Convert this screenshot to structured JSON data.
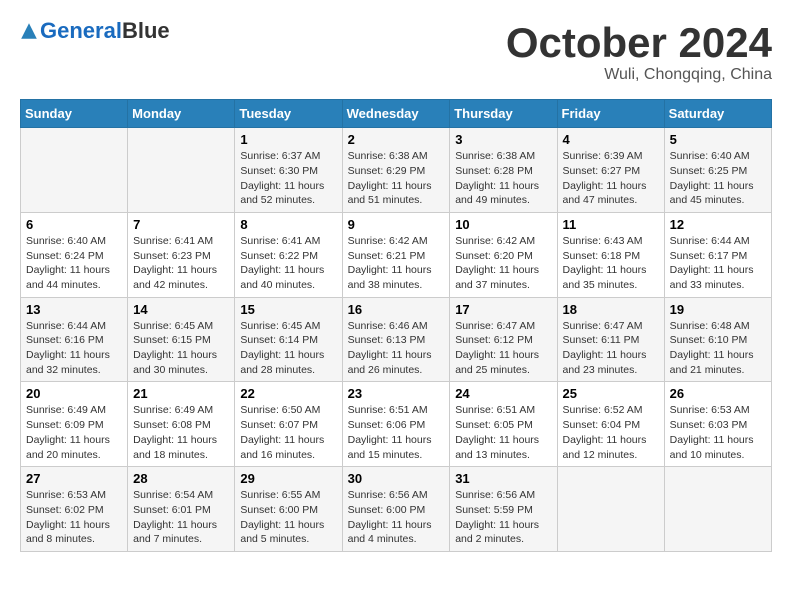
{
  "header": {
    "logo_line1": "General",
    "logo_line2": "Blue",
    "month": "October 2024",
    "location": "Wuli, Chongqing, China"
  },
  "days_of_week": [
    "Sunday",
    "Monday",
    "Tuesday",
    "Wednesday",
    "Thursday",
    "Friday",
    "Saturday"
  ],
  "weeks": [
    [
      {
        "day": "",
        "info": ""
      },
      {
        "day": "",
        "info": ""
      },
      {
        "day": "1",
        "info": "Sunrise: 6:37 AM\nSunset: 6:30 PM\nDaylight: 11 hours and 52 minutes."
      },
      {
        "day": "2",
        "info": "Sunrise: 6:38 AM\nSunset: 6:29 PM\nDaylight: 11 hours and 51 minutes."
      },
      {
        "day": "3",
        "info": "Sunrise: 6:38 AM\nSunset: 6:28 PM\nDaylight: 11 hours and 49 minutes."
      },
      {
        "day": "4",
        "info": "Sunrise: 6:39 AM\nSunset: 6:27 PM\nDaylight: 11 hours and 47 minutes."
      },
      {
        "day": "5",
        "info": "Sunrise: 6:40 AM\nSunset: 6:25 PM\nDaylight: 11 hours and 45 minutes."
      }
    ],
    [
      {
        "day": "6",
        "info": "Sunrise: 6:40 AM\nSunset: 6:24 PM\nDaylight: 11 hours and 44 minutes."
      },
      {
        "day": "7",
        "info": "Sunrise: 6:41 AM\nSunset: 6:23 PM\nDaylight: 11 hours and 42 minutes."
      },
      {
        "day": "8",
        "info": "Sunrise: 6:41 AM\nSunset: 6:22 PM\nDaylight: 11 hours and 40 minutes."
      },
      {
        "day": "9",
        "info": "Sunrise: 6:42 AM\nSunset: 6:21 PM\nDaylight: 11 hours and 38 minutes."
      },
      {
        "day": "10",
        "info": "Sunrise: 6:42 AM\nSunset: 6:20 PM\nDaylight: 11 hours and 37 minutes."
      },
      {
        "day": "11",
        "info": "Sunrise: 6:43 AM\nSunset: 6:18 PM\nDaylight: 11 hours and 35 minutes."
      },
      {
        "day": "12",
        "info": "Sunrise: 6:44 AM\nSunset: 6:17 PM\nDaylight: 11 hours and 33 minutes."
      }
    ],
    [
      {
        "day": "13",
        "info": "Sunrise: 6:44 AM\nSunset: 6:16 PM\nDaylight: 11 hours and 32 minutes."
      },
      {
        "day": "14",
        "info": "Sunrise: 6:45 AM\nSunset: 6:15 PM\nDaylight: 11 hours and 30 minutes."
      },
      {
        "day": "15",
        "info": "Sunrise: 6:45 AM\nSunset: 6:14 PM\nDaylight: 11 hours and 28 minutes."
      },
      {
        "day": "16",
        "info": "Sunrise: 6:46 AM\nSunset: 6:13 PM\nDaylight: 11 hours and 26 minutes."
      },
      {
        "day": "17",
        "info": "Sunrise: 6:47 AM\nSunset: 6:12 PM\nDaylight: 11 hours and 25 minutes."
      },
      {
        "day": "18",
        "info": "Sunrise: 6:47 AM\nSunset: 6:11 PM\nDaylight: 11 hours and 23 minutes."
      },
      {
        "day": "19",
        "info": "Sunrise: 6:48 AM\nSunset: 6:10 PM\nDaylight: 11 hours and 21 minutes."
      }
    ],
    [
      {
        "day": "20",
        "info": "Sunrise: 6:49 AM\nSunset: 6:09 PM\nDaylight: 11 hours and 20 minutes."
      },
      {
        "day": "21",
        "info": "Sunrise: 6:49 AM\nSunset: 6:08 PM\nDaylight: 11 hours and 18 minutes."
      },
      {
        "day": "22",
        "info": "Sunrise: 6:50 AM\nSunset: 6:07 PM\nDaylight: 11 hours and 16 minutes."
      },
      {
        "day": "23",
        "info": "Sunrise: 6:51 AM\nSunset: 6:06 PM\nDaylight: 11 hours and 15 minutes."
      },
      {
        "day": "24",
        "info": "Sunrise: 6:51 AM\nSunset: 6:05 PM\nDaylight: 11 hours and 13 minutes."
      },
      {
        "day": "25",
        "info": "Sunrise: 6:52 AM\nSunset: 6:04 PM\nDaylight: 11 hours and 12 minutes."
      },
      {
        "day": "26",
        "info": "Sunrise: 6:53 AM\nSunset: 6:03 PM\nDaylight: 11 hours and 10 minutes."
      }
    ],
    [
      {
        "day": "27",
        "info": "Sunrise: 6:53 AM\nSunset: 6:02 PM\nDaylight: 11 hours and 8 minutes."
      },
      {
        "day": "28",
        "info": "Sunrise: 6:54 AM\nSunset: 6:01 PM\nDaylight: 11 hours and 7 minutes."
      },
      {
        "day": "29",
        "info": "Sunrise: 6:55 AM\nSunset: 6:00 PM\nDaylight: 11 hours and 5 minutes."
      },
      {
        "day": "30",
        "info": "Sunrise: 6:56 AM\nSunset: 6:00 PM\nDaylight: 11 hours and 4 minutes."
      },
      {
        "day": "31",
        "info": "Sunrise: 6:56 AM\nSunset: 5:59 PM\nDaylight: 11 hours and 2 minutes."
      },
      {
        "day": "",
        "info": ""
      },
      {
        "day": "",
        "info": ""
      }
    ]
  ]
}
